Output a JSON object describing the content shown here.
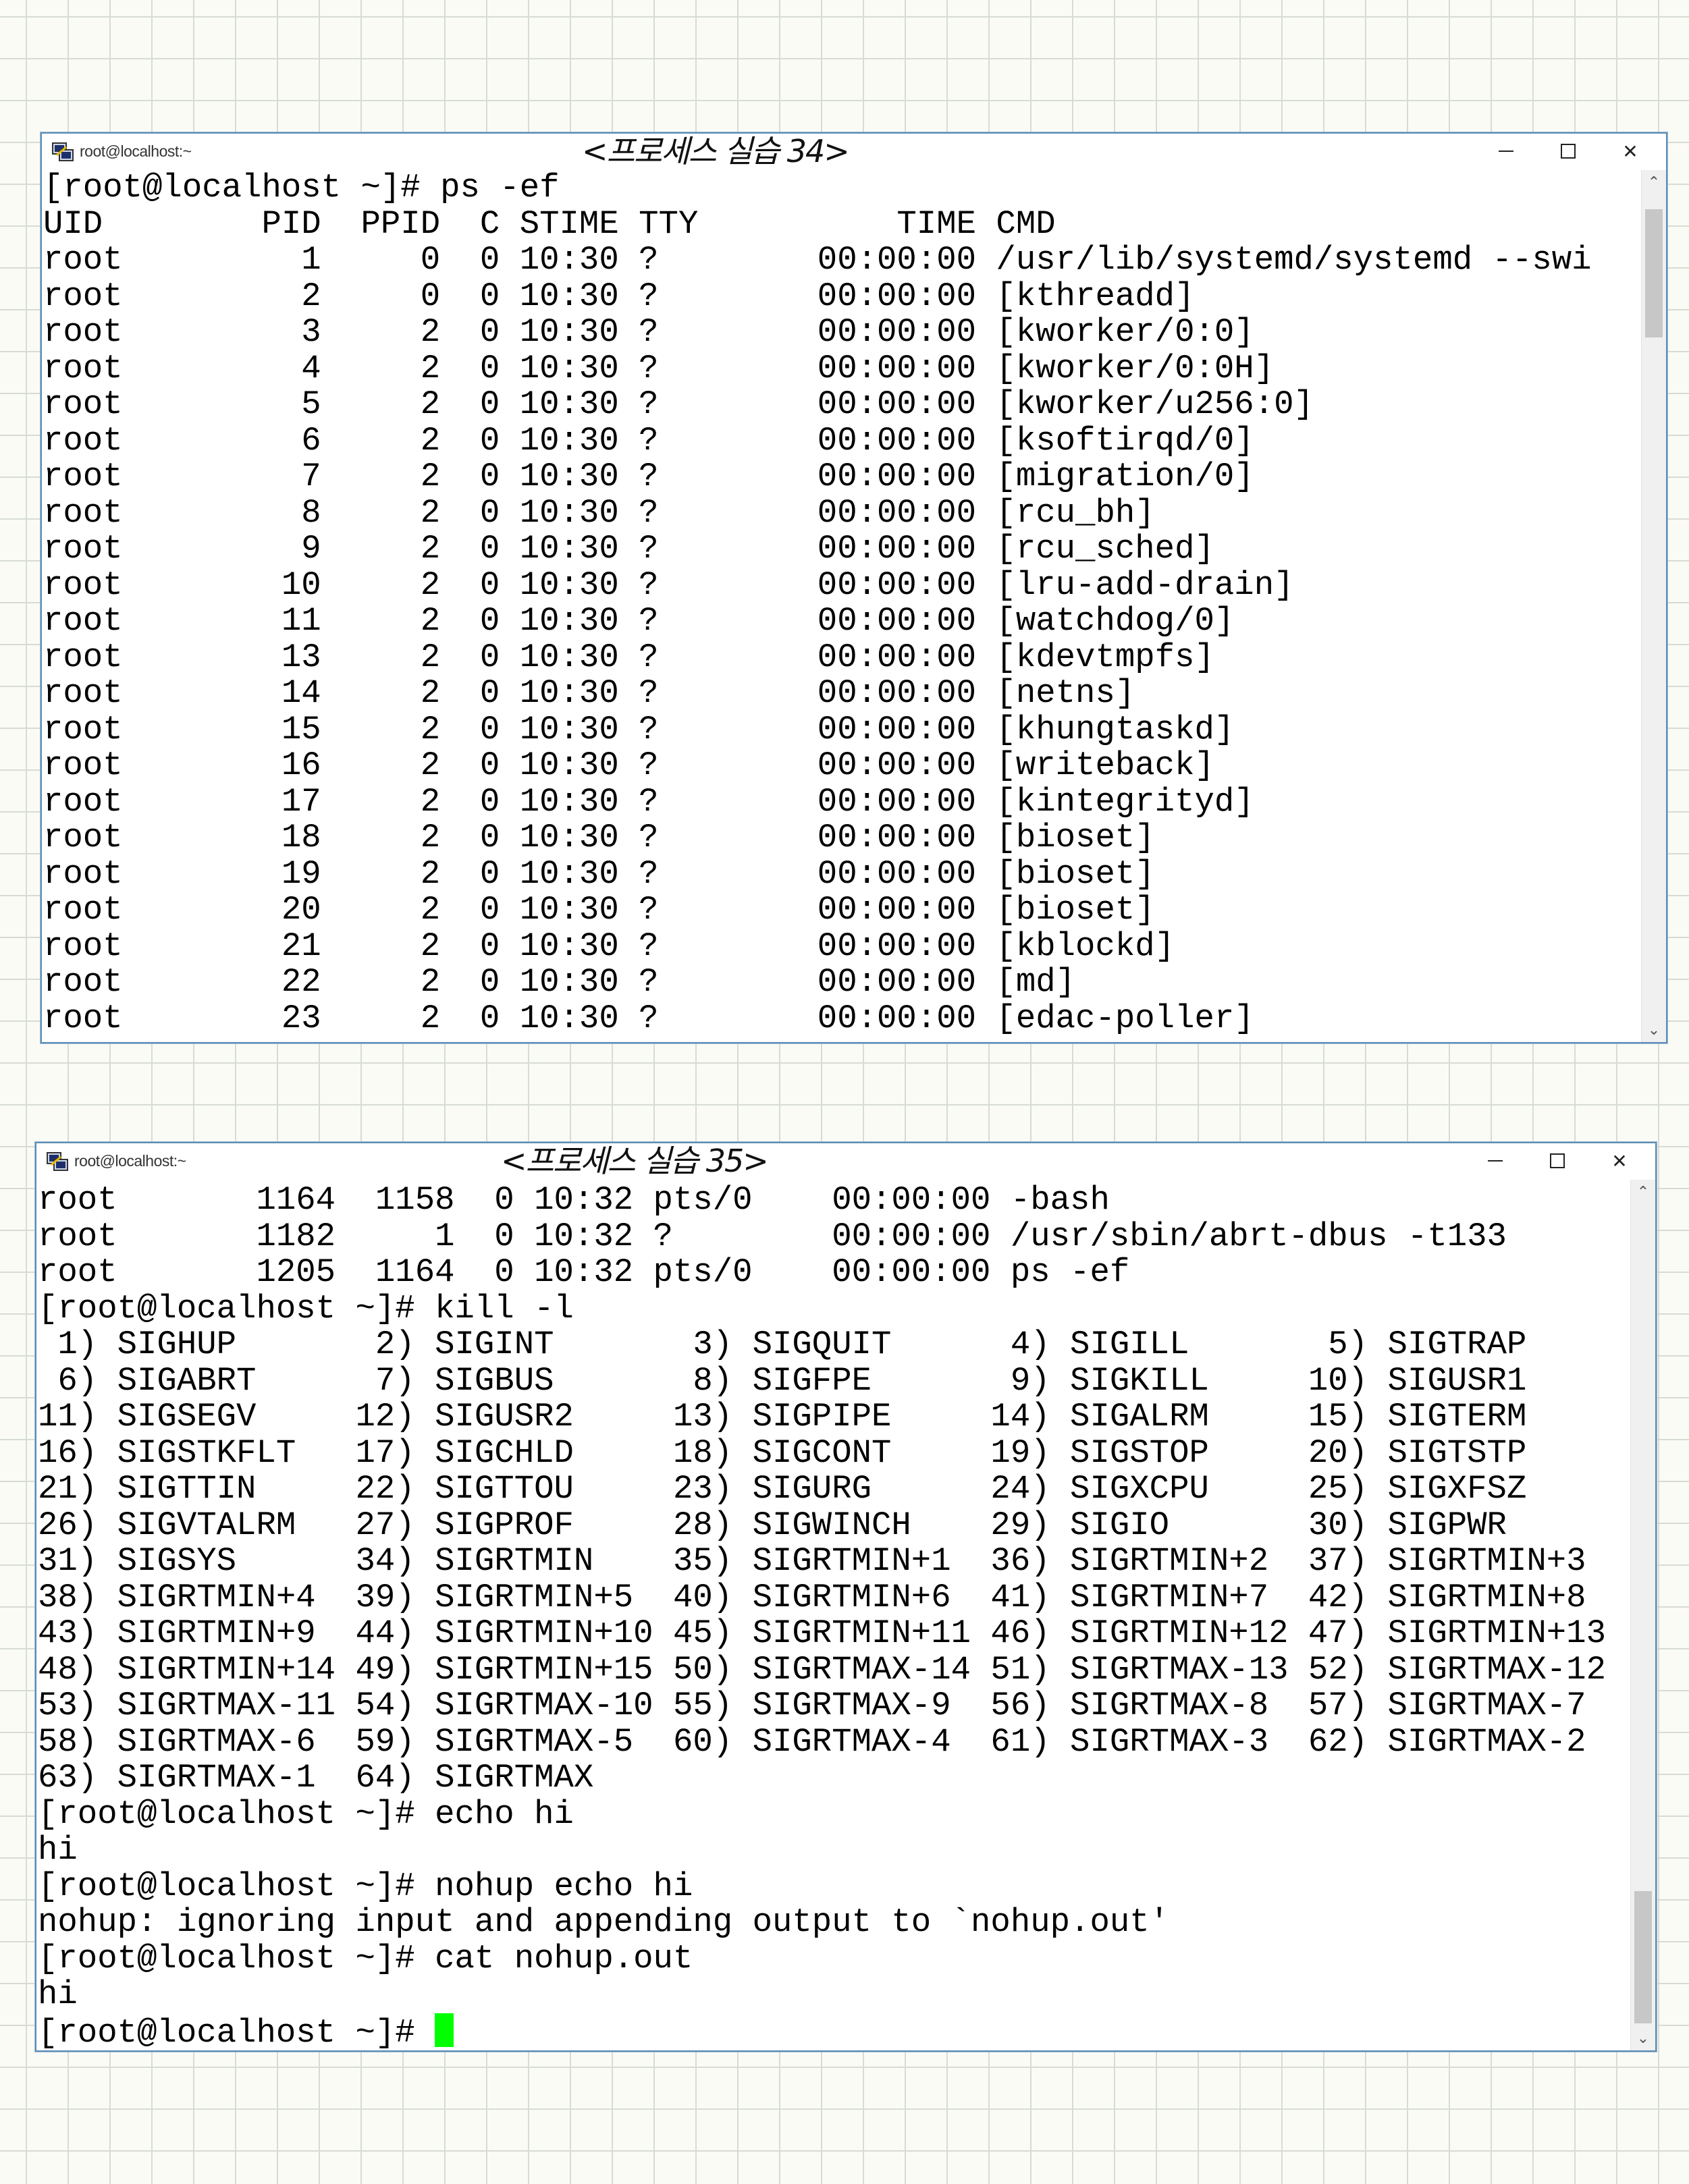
{
  "window1": {
    "title": "root@localhost:~",
    "annotation": "<프로세스 실습 34>",
    "lines": [
      "[root@localhost ~]# ps -ef",
      "UID        PID  PPID  C STIME TTY          TIME CMD",
      "root         1     0  0 10:30 ?        00:00:00 /usr/lib/systemd/systemd --swi",
      "root         2     0  0 10:30 ?        00:00:00 [kthreadd]",
      "root         3     2  0 10:30 ?        00:00:00 [kworker/0:0]",
      "root         4     2  0 10:30 ?        00:00:00 [kworker/0:0H]",
      "root         5     2  0 10:30 ?        00:00:00 [kworker/u256:0]",
      "root         6     2  0 10:30 ?        00:00:00 [ksoftirqd/0]",
      "root         7     2  0 10:30 ?        00:00:00 [migration/0]",
      "root         8     2  0 10:30 ?        00:00:00 [rcu_bh]",
      "root         9     2  0 10:30 ?        00:00:00 [rcu_sched]",
      "root        10     2  0 10:30 ?        00:00:00 [lru-add-drain]",
      "root        11     2  0 10:30 ?        00:00:00 [watchdog/0]",
      "root        13     2  0 10:30 ?        00:00:00 [kdevtmpfs]",
      "root        14     2  0 10:30 ?        00:00:00 [netns]",
      "root        15     2  0 10:30 ?        00:00:00 [khungtaskd]",
      "root        16     2  0 10:30 ?        00:00:00 [writeback]",
      "root        17     2  0 10:30 ?        00:00:00 [kintegrityd]",
      "root        18     2  0 10:30 ?        00:00:00 [bioset]",
      "root        19     2  0 10:30 ?        00:00:00 [bioset]",
      "root        20     2  0 10:30 ?        00:00:00 [bioset]",
      "root        21     2  0 10:30 ?        00:00:00 [kblockd]",
      "root        22     2  0 10:30 ?        00:00:00 [md]",
      "root        23     2  0 10:30 ?        00:00:00 [edac-poller]"
    ]
  },
  "window2": {
    "title": "root@localhost:~",
    "annotation": "<프로세스 실습 35>",
    "lines": [
      "root       1164  1158  0 10:32 pts/0    00:00:00 -bash",
      "root       1182     1  0 10:32 ?        00:00:00 /usr/sbin/abrt-dbus -t133",
      "root       1205  1164  0 10:32 pts/0    00:00:00 ps -ef",
      "[root@localhost ~]# kill -l",
      " 1) SIGHUP       2) SIGINT       3) SIGQUIT      4) SIGILL       5) SIGTRAP",
      " 6) SIGABRT      7) SIGBUS       8) SIGFPE       9) SIGKILL     10) SIGUSR1",
      "11) SIGSEGV     12) SIGUSR2     13) SIGPIPE     14) SIGALRM     15) SIGTERM",
      "16) SIGSTKFLT   17) SIGCHLD     18) SIGCONT     19) SIGSTOP     20) SIGTSTP",
      "21) SIGTTIN     22) SIGTTOU     23) SIGURG      24) SIGXCPU     25) SIGXFSZ",
      "26) SIGVTALRM   27) SIGPROF     28) SIGWINCH    29) SIGIO       30) SIGPWR",
      "31) SIGSYS      34) SIGRTMIN    35) SIGRTMIN+1  36) SIGRTMIN+2  37) SIGRTMIN+3",
      "38) SIGRTMIN+4  39) SIGRTMIN+5  40) SIGRTMIN+6  41) SIGRTMIN+7  42) SIGRTMIN+8",
      "43) SIGRTMIN+9  44) SIGRTMIN+10 45) SIGRTMIN+11 46) SIGRTMIN+12 47) SIGRTMIN+13",
      "48) SIGRTMIN+14 49) SIGRTMIN+15 50) SIGRTMAX-14 51) SIGRTMAX-13 52) SIGRTMAX-12",
      "53) SIGRTMAX-11 54) SIGRTMAX-10 55) SIGRTMAX-9  56) SIGRTMAX-8  57) SIGRTMAX-7",
      "58) SIGRTMAX-6  59) SIGRTMAX-5  60) SIGRTMAX-4  61) SIGRTMAX-3  62) SIGRTMAX-2",
      "63) SIGRTMAX-1  64) SIGRTMAX",
      "[root@localhost ~]# echo hi",
      "hi",
      "[root@localhost ~]# nohup echo hi",
      "nohup: ignoring input and appending output to `nohup.out'",
      "[root@localhost ~]# cat nohup.out",
      "hi"
    ],
    "prompt": "[root@localhost ~]# "
  },
  "icons": {
    "app": "putty-icon",
    "minimize": "minimize-icon",
    "maximize": "maximize-icon",
    "close": "close-icon",
    "close_glyph": "✕",
    "scroll_up_glyph": "⌃",
    "scroll_down_glyph": "⌄"
  },
  "colors": {
    "cursor": "#00ff00",
    "window_border": "#5d8db6",
    "terminal_bg": "#ffffff",
    "terminal_fg": "#000000"
  }
}
